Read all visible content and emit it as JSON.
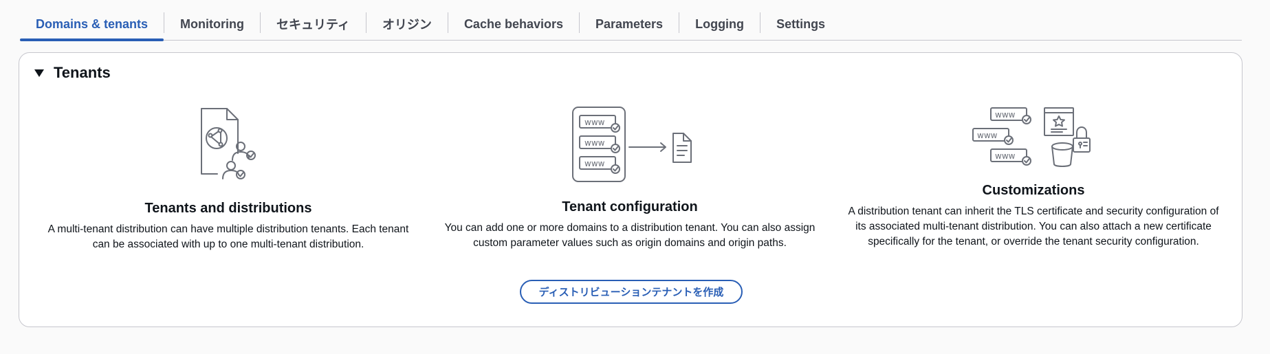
{
  "tabs": [
    {
      "label": "Domains & tenants",
      "active": true
    },
    {
      "label": "Monitoring",
      "active": false
    },
    {
      "label": "セキュリティ",
      "active": false
    },
    {
      "label": "オリジン",
      "active": false
    },
    {
      "label": "Cache behaviors",
      "active": false
    },
    {
      "label": "Parameters",
      "active": false
    },
    {
      "label": "Logging",
      "active": false
    },
    {
      "label": "Settings",
      "active": false
    }
  ],
  "panel": {
    "title": "Tenants",
    "expanded": true,
    "columns": [
      {
        "icon": "document-globe-users-icon",
        "title": "Tenants and distributions",
        "description_lines": [
          "A multi-tenant distribution can have multiple distribution tenants. Each tenant",
          "can be associated with up to one multi-tenant distribution."
        ]
      },
      {
        "icon": "www-domains-to-document-icon",
        "title": "Tenant configuration",
        "description_lines": [
          "You can add one or more domains to a distribution tenant. You can also assign",
          "custom parameter values such as origin domains and origin paths."
        ]
      },
      {
        "icon": "www-certificate-lock-bucket-icon",
        "title": "Customizations",
        "description_lines": [
          "A distribution tenant can inherit the TLS certificate and security configuration of",
          "its associated multi-tenant distribution. You can also attach a new certificate",
          "specifically for the tenant, or override the tenant security configuration."
        ]
      }
    ],
    "create_button_label": "ディストリビューションテナントを作成"
  },
  "colors": {
    "accent": "#295eb5",
    "text": "#0f141a",
    "tab_text": "#424650",
    "border": "#c6c6cd",
    "icon_stroke": "#6b6f78"
  }
}
